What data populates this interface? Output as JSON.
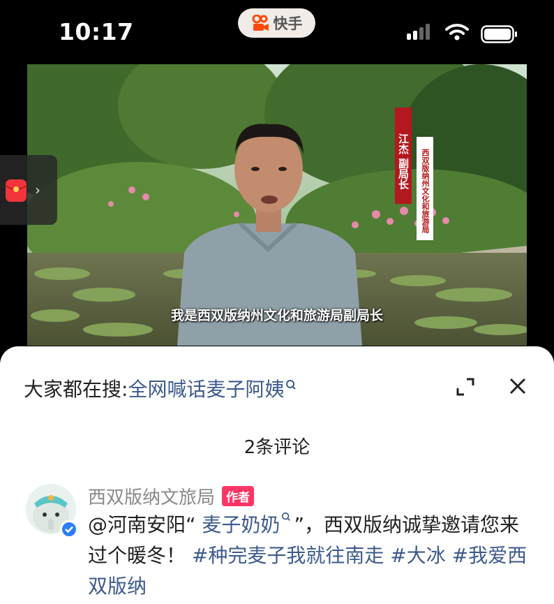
{
  "status_bar": {
    "time": "10:17",
    "app_name": "快手",
    "brand_color": "#ff4906"
  },
  "video": {
    "subtitle": "我是西双版纳州文化和旅游局副局长",
    "name_banner": "江杰 副局长",
    "org_banner": "西双版纳州文化和旅游局"
  },
  "comment_sheet": {
    "search_prefix": "大家都在搜:",
    "search_term": "全网喊话麦子阿姨",
    "comment_count": "2条评论",
    "comments": [
      {
        "author": "西双版纳文旅局",
        "badge": "作者",
        "mention_prefix": "@河南安阳“",
        "mention_name": "麦子奶奶",
        "text_main": "”，西双版纳诚挚邀请您来过个暖冬！",
        "hashtag_1": "#种完麦子我就往南走",
        "hashtag_2": "#大冰",
        "hashtag_3": "#我爱西双版纳"
      }
    ]
  },
  "icons": [
    "signal-icon",
    "wifi-icon",
    "battery-icon",
    "red-packet-icon",
    "chevron-right-icon",
    "search-icon",
    "expand-icon",
    "close-icon",
    "verified-icon"
  ]
}
